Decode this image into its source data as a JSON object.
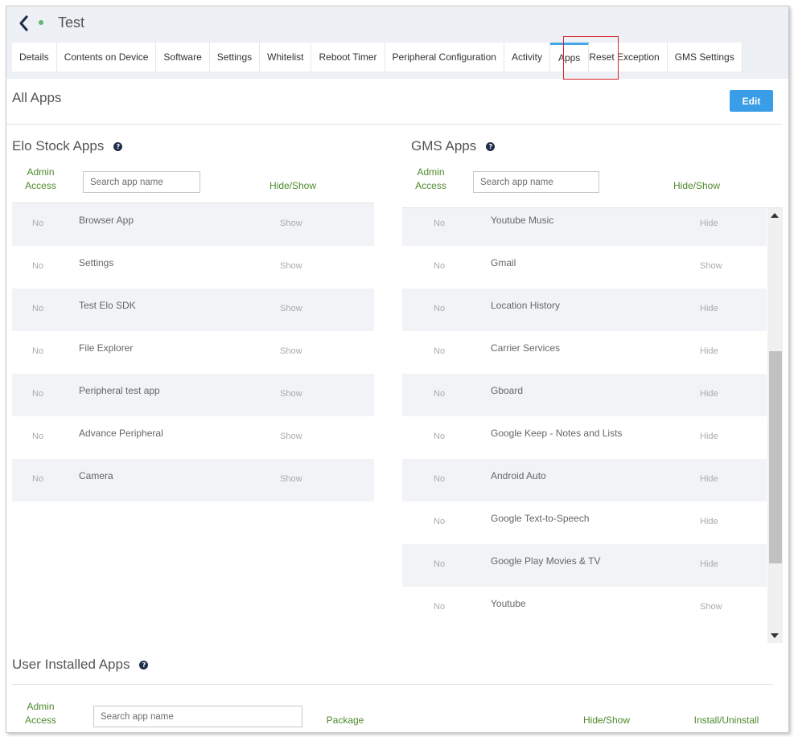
{
  "header": {
    "title": "Test"
  },
  "tabs": [
    {
      "label": "Details"
    },
    {
      "label": "Contents on Device"
    },
    {
      "label": "Software"
    },
    {
      "label": "Settings"
    },
    {
      "label": "Whitelist"
    },
    {
      "label": "Reboot Timer"
    },
    {
      "label": "Peripheral Configuration"
    },
    {
      "label": "Activity"
    },
    {
      "label": "Apps"
    },
    {
      "label": "Reset Exception"
    },
    {
      "label": "GMS Settings"
    }
  ],
  "active_tab": "Apps",
  "all_apps": {
    "title": "All Apps",
    "edit_label": "Edit"
  },
  "elo_stock": {
    "title": "Elo Stock Apps",
    "admin_access_label": "Admin Access",
    "search_placeholder": "Search app name",
    "hide_show_label": "Hide/Show",
    "rows": [
      {
        "access": "No",
        "name": "Browser App",
        "toggle": "Show"
      },
      {
        "access": "No",
        "name": "Settings",
        "toggle": "Show"
      },
      {
        "access": "No",
        "name": "Test Elo SDK",
        "toggle": "Show"
      },
      {
        "access": "No",
        "name": "File Explorer",
        "toggle": "Show"
      },
      {
        "access": "No",
        "name": "Peripheral test app",
        "toggle": "Show"
      },
      {
        "access": "No",
        "name": "Advance Peripheral",
        "toggle": "Show"
      },
      {
        "access": "No",
        "name": "Camera",
        "toggle": "Show"
      }
    ]
  },
  "gms": {
    "title": "GMS Apps",
    "admin_access_label": "Admin Access",
    "search_placeholder": "Search app name",
    "hide_show_label": "Hide/Show",
    "rows": [
      {
        "access": "No",
        "name": "Youtube Music",
        "toggle": "Hide"
      },
      {
        "access": "No",
        "name": "Gmail",
        "toggle": "Show"
      },
      {
        "access": "No",
        "name": "Location History",
        "toggle": "Hide"
      },
      {
        "access": "No",
        "name": "Carrier Services",
        "toggle": "Hide"
      },
      {
        "access": "No",
        "name": "Gboard",
        "toggle": "Hide"
      },
      {
        "access": "No",
        "name": "Google Keep - Notes and Lists",
        "toggle": "Hide"
      },
      {
        "access": "No",
        "name": "Android Auto",
        "toggle": "Hide"
      },
      {
        "access": "No",
        "name": "Google Text-to-Speech",
        "toggle": "Hide"
      },
      {
        "access": "No",
        "name": "Google Play Movies & TV",
        "toggle": "Hide"
      },
      {
        "access": "No",
        "name": "Youtube",
        "toggle": "Show"
      }
    ]
  },
  "user_installed": {
    "title": "User Installed Apps",
    "admin_access_label": "Admin Access",
    "search_placeholder": "Search app name",
    "package_label": "Package",
    "hide_show_label": "Hide/Show",
    "install_label": "Install/Uninstall"
  },
  "colors": {
    "accent": "#3a9de8",
    "header_bg": "#edf0f4",
    "column_header": "#4d8a2d",
    "highlight": "#d9262b",
    "status_dot": "#5fb96f"
  }
}
